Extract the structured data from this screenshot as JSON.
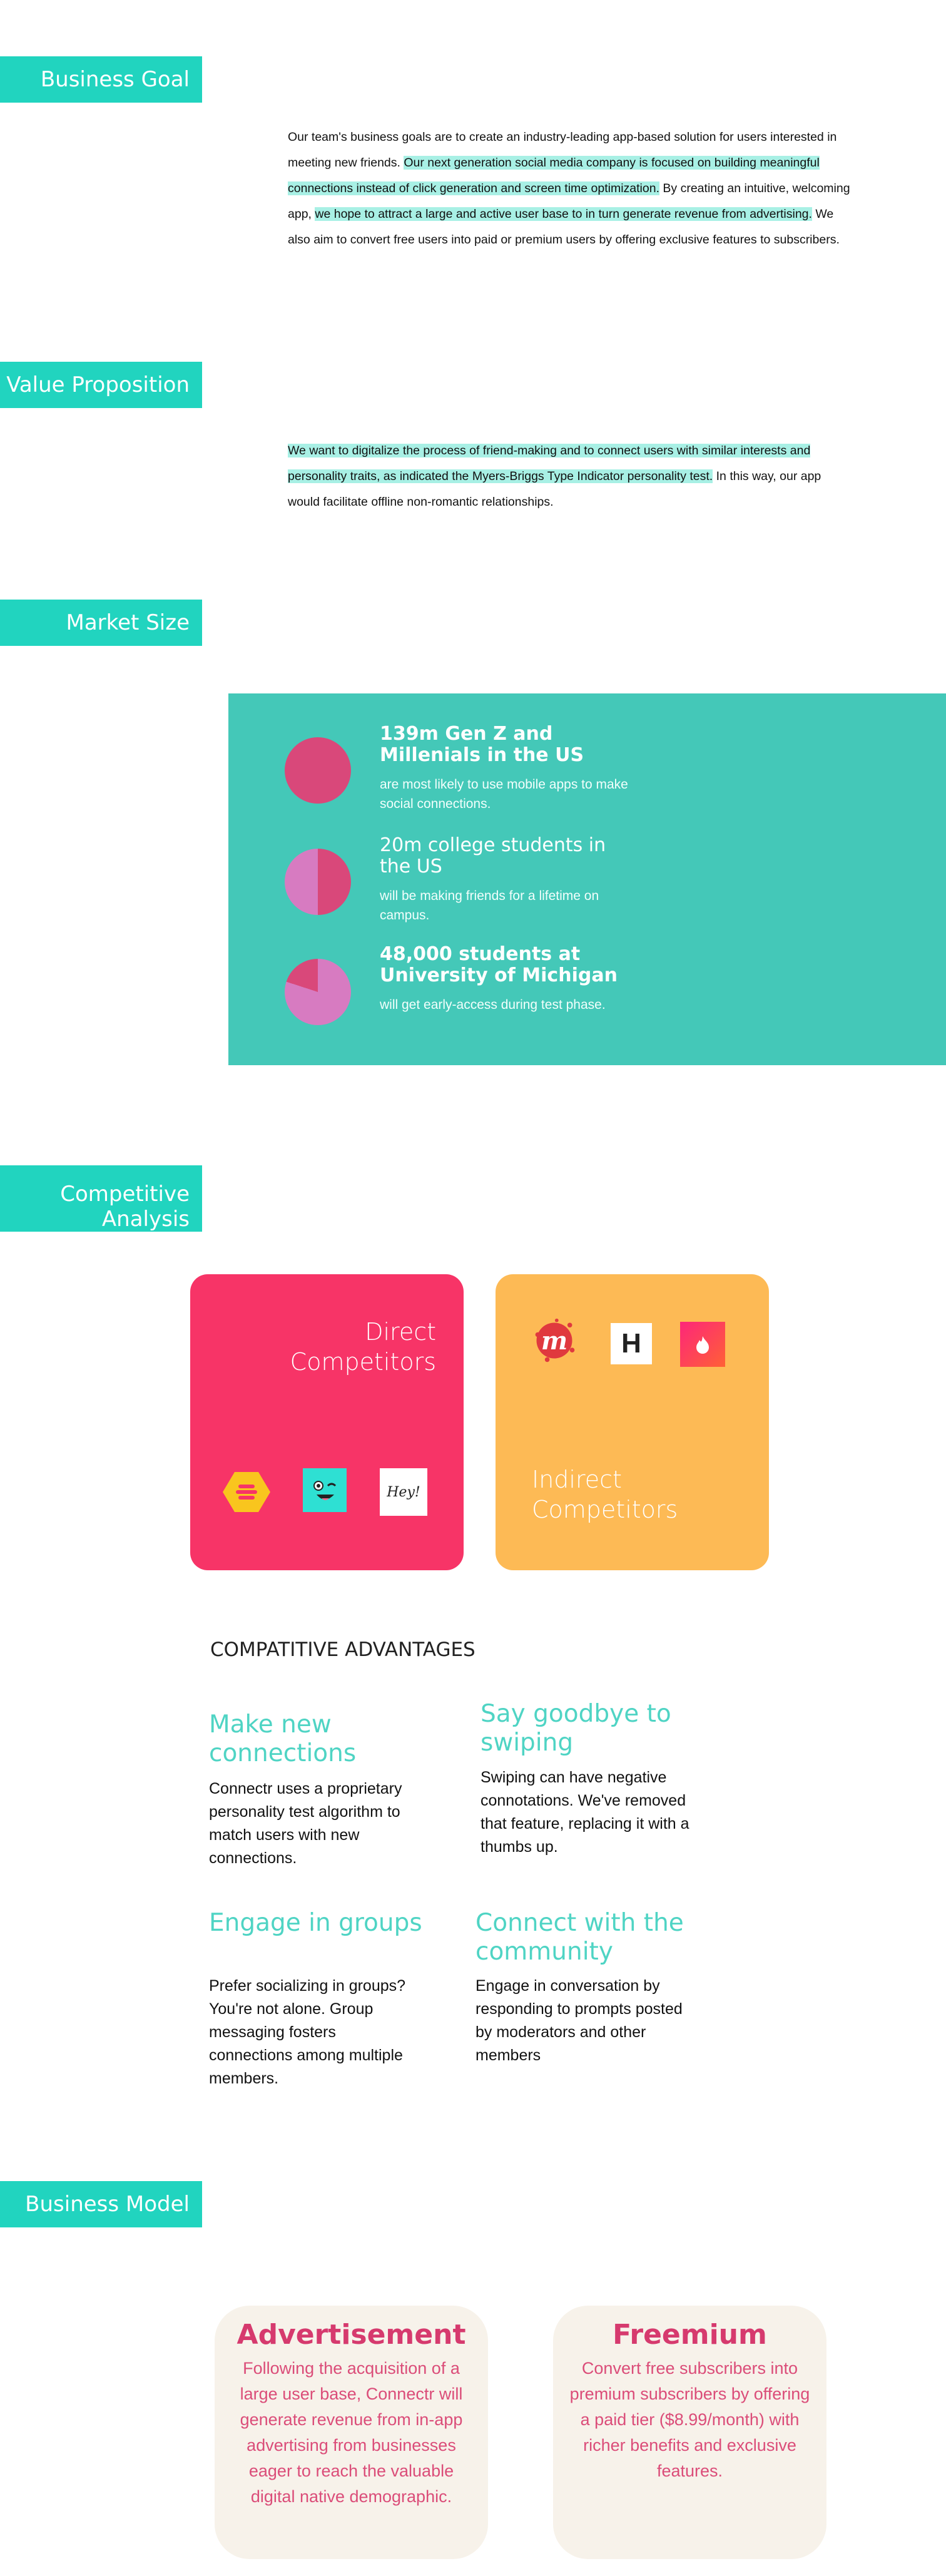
{
  "sections": {
    "business_goal": "Business Goal",
    "value_proposition": "Value Proposition",
    "market_size": "Market Size",
    "competitive_analysis_line1": "Competitive",
    "competitive_analysis_line2": "Analysis",
    "business_model": "Business Model"
  },
  "business_goal_text": {
    "p1": "Our team's business goals are to create an industry-leading app-based solution for users interested in meeting new friends. ",
    "p2": "Our next generation social media company is focused on building meaningful connections instead of click generation and screen time optimization.",
    "p3": "  By creating an intuitive, welcoming app, ",
    "p4": "we hope to attract a large and active user base to in turn generate revenue from advertising.",
    "p5": " We also aim to convert free users into paid or premium users by offering exclusive features to subscribers."
  },
  "value_prop_text": {
    "p1": "We want to digitalize the process of friend-making and to connect users with similar interests and personality traits, as indicated the Myers-Briggs Type Indicator personality test.",
    "p2": " In this way, our app would facilitate offline non-romantic relationships."
  },
  "market": [
    {
      "title": "139m Gen Z and Millenials in the US",
      "sub": "are most likely to use mobile apps to make social connections.",
      "fraction": 1.0
    },
    {
      "title": "20m college students in the US",
      "sub": "will be making friends for a lifetime on campus.",
      "fraction": 0.5
    },
    {
      "title": "48,000 students at University of Michigan",
      "sub": "will get early-access during test phase.",
      "fraction": 0.2
    }
  ],
  "colors": {
    "accent": "#21d4bf",
    "market_bg": "#44c8b8",
    "pink": "#f73467",
    "orange": "#fdba55",
    "pie_main": "#d9487a",
    "pie_alt": "#d77bc1"
  },
  "competitors": {
    "direct_line1": "Direct",
    "direct_line2": "Competitors",
    "indirect_line1": "Indirect",
    "indirect_line2": "Competitors",
    "direct_logos": [
      "bumble-logo-icon",
      "wink-logo-icon",
      "hey-vina-logo-icon"
    ],
    "indirect_logos": [
      "meetup-logo-icon",
      "hinge-logo-icon",
      "tinder-logo-icon"
    ],
    "hey_text": "Hey!",
    "meetup_text": "m",
    "hinge_text": "H"
  },
  "advantages": {
    "heading": "COMPATITIVE ADVANTAGES",
    "items": [
      {
        "title": "Make new connections",
        "text": "Connectr uses a proprietary personality test algorithm to match users with new connections."
      },
      {
        "title": "Say goodbye to swiping",
        "text": "Swiping can have negative connotations. We've removed that feature, replacing it with a thumbs up."
      },
      {
        "title": "Engage in groups",
        "text": "Prefer socializing in groups? You're not alone. Group messaging fosters connections among multiple members."
      },
      {
        "title": "Connect with the community",
        "text": "Engage in conversation by responding to prompts posted by moderators and other members"
      }
    ]
  },
  "business_model": [
    {
      "title": "Advertisement",
      "text": "Following the acquisition of a large user base, Connectr will generate revenue from in-app advertising from businesses eager to reach the valuable digital native demographic."
    },
    {
      "title": "Freemium",
      "text": "Convert free subscribers into premium subscribers by offering a paid tier ($8.99/month) with richer benefits and exclusive features."
    }
  ]
}
